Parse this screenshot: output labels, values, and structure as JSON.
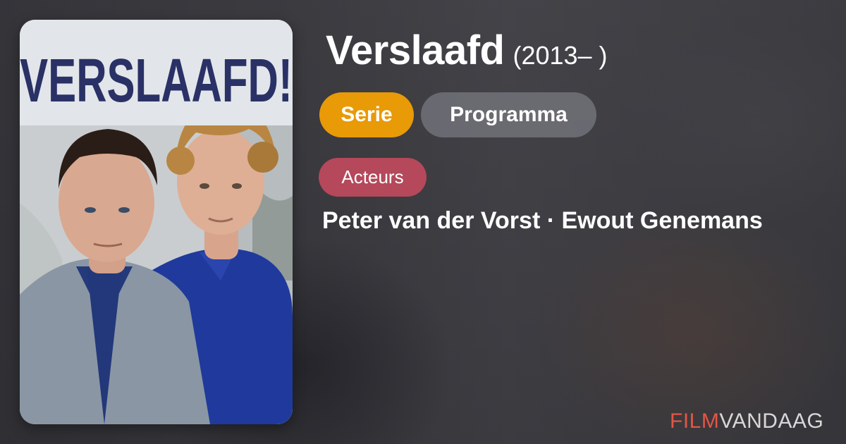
{
  "poster": {
    "title_text": "VERSLAAFD!",
    "image_description": "Two men in blue shirts, one in a grey jacket, in front of a weathered wall"
  },
  "show": {
    "title": "Verslaafd",
    "year": "(2013– )"
  },
  "tags": {
    "type_label": "Serie",
    "category_label": "Programma"
  },
  "actors": {
    "heading": "Acteurs",
    "names": "Peter van der Vorst · Ewout Genemans"
  },
  "brand": {
    "part1": "FILM",
    "part2": "VANDAAG"
  },
  "colors": {
    "serie_pill": "#e89a07",
    "programma_pill": "#78787f",
    "acteurs_pill": "#b5485a",
    "logo_film": "#e25546",
    "logo_vandaag": "#d8d8d8"
  }
}
